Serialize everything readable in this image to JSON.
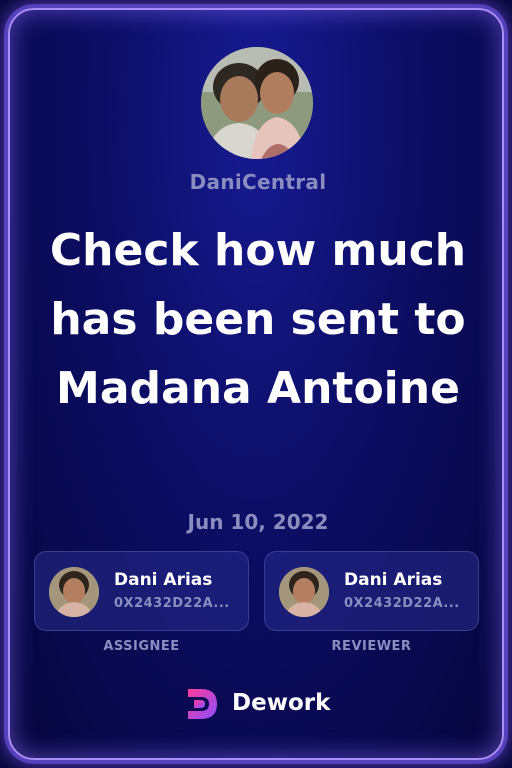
{
  "organization": {
    "name": "DaniCentral",
    "avatar_icon": "group-photo-avatar"
  },
  "task": {
    "title": "Check how much has been sent to Madana Antoine",
    "date": "Jun 10, 2022"
  },
  "assignee": {
    "name": "Dani Arias",
    "address": "0X2432D22A...",
    "role_label": "ASSIGNEE"
  },
  "reviewer": {
    "name": "Dani Arias",
    "address": "0X2432D22A...",
    "role_label": "REVIEWER"
  },
  "brand": {
    "name": "Dework",
    "logo_icon": "dework-logo-icon"
  },
  "colors": {
    "background": "#0c0e67",
    "border_glow": "#a98df8",
    "muted_text": "#8b8dc0",
    "title_text": "#ffffff"
  }
}
